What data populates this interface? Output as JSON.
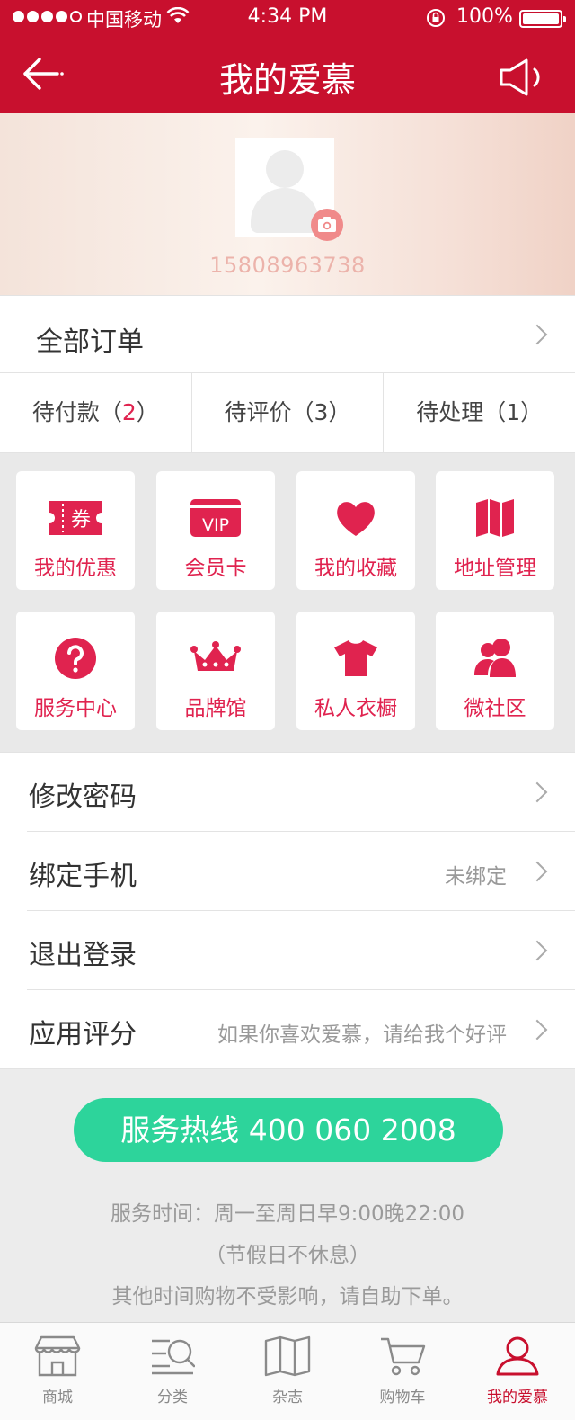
{
  "status_bar": {
    "carrier": "中国移动",
    "time": "4:34 PM",
    "battery": "100%"
  },
  "nav": {
    "title": "我的爱慕"
  },
  "profile": {
    "phone": "15808963738"
  },
  "orders": {
    "all_label": "全部订单",
    "tabs": [
      {
        "label": "待付款（",
        "count": "2",
        "close": "）"
      },
      {
        "label": "待评价（",
        "count": "3",
        "close": "）"
      },
      {
        "label": "待处理（",
        "count": "1",
        "close": "）"
      }
    ]
  },
  "grid": {
    "items": [
      {
        "label": "我的优惠",
        "icon": "coupon-icon"
      },
      {
        "label": "会员卡",
        "icon": "vip-card-icon"
      },
      {
        "label": "我的收藏",
        "icon": "heart-icon"
      },
      {
        "label": "地址管理",
        "icon": "map-icon"
      },
      {
        "label": "服务中心",
        "icon": "question-icon"
      },
      {
        "label": "品牌馆",
        "icon": "crown-icon"
      },
      {
        "label": "私人衣橱",
        "icon": "shirt-icon"
      },
      {
        "label": "微社区",
        "icon": "community-icon"
      }
    ],
    "coupon_text": "券",
    "vip_text": "VIP",
    "accent_color": "#e0234f"
  },
  "settings": [
    {
      "label": "修改密码",
      "value": ""
    },
    {
      "label": "绑定手机",
      "value": "未绑定"
    },
    {
      "label": "退出登录",
      "value": ""
    },
    {
      "label": "应用评分",
      "value": "如果你喜欢爱慕，请给我个好评"
    }
  ],
  "hotline": {
    "label": "服务热线 400 060 2008",
    "hours_1": "服务时间：周一至周日早9:00晚22:00",
    "hours_2": "（节假日不休息）",
    "hours_3": "其他时间购物不受影响，请自助下单。"
  },
  "tabbar": {
    "items": [
      {
        "label": "商城",
        "icon": "store-icon"
      },
      {
        "label": "分类",
        "icon": "category-search-icon"
      },
      {
        "label": "杂志",
        "icon": "magazine-icon"
      },
      {
        "label": "购物车",
        "icon": "cart-icon"
      },
      {
        "label": "我的爱慕",
        "icon": "user-icon",
        "active": true
      }
    ]
  },
  "colors": {
    "brand_red": "#c8102e",
    "accent_pink": "#e0234f",
    "hotline_green": "#2dd49b"
  }
}
